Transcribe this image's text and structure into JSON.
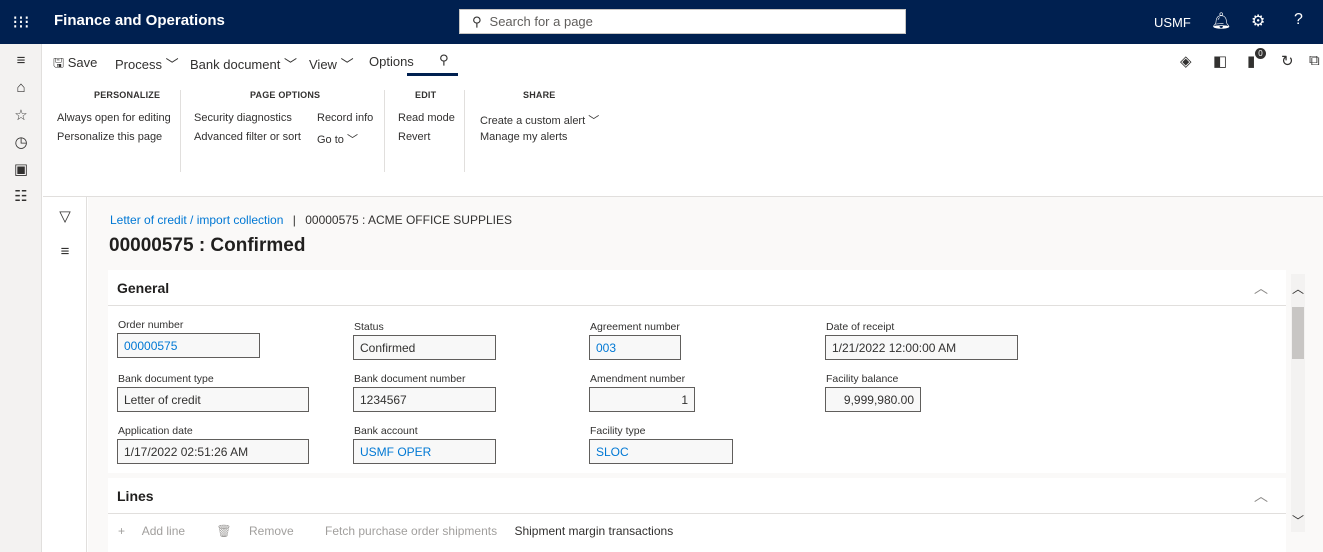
{
  "topbar": {
    "app_title": "Finance and Operations",
    "search_placeholder": "Search for a page",
    "company": "USMF",
    "help": "?"
  },
  "actions": {
    "save": "Save",
    "process": "Process",
    "bank_document": "Bank document",
    "view": "View",
    "options": "Options",
    "notification_count": "0"
  },
  "ribbon": {
    "personalize": {
      "title": "PERSONALIZE",
      "items": [
        "Always open for editing",
        "Personalize this page"
      ]
    },
    "page_options": {
      "title": "PAGE OPTIONS",
      "col1": [
        "Security diagnostics",
        "Advanced filter or sort"
      ],
      "col2": [
        "Record info",
        "Go to"
      ]
    },
    "edit": {
      "title": "EDIT",
      "items": [
        "Read mode",
        "Revert"
      ]
    },
    "share": {
      "title": "SHARE",
      "items": [
        "Create a custom alert",
        "Manage my alerts"
      ]
    }
  },
  "breadcrumb": {
    "link": "Letter of credit / import collection",
    "separator": "|",
    "current": "00000575 : ACME OFFICE SUPPLIES"
  },
  "page_title": "00000575 : Confirmed",
  "general": {
    "title": "General",
    "order_number": {
      "label": "Order number",
      "value": "00000575"
    },
    "status": {
      "label": "Status",
      "value": "Confirmed"
    },
    "agreement_number": {
      "label": "Agreement number",
      "value": "003"
    },
    "date_of_receipt": {
      "label": "Date of receipt",
      "value": "1/21/2022 12:00:00 AM"
    },
    "bank_document_type": {
      "label": "Bank document type",
      "value": "Letter of credit"
    },
    "bank_document_number": {
      "label": "Bank document number",
      "value": "1234567"
    },
    "amendment_number": {
      "label": "Amendment number",
      "value": "1"
    },
    "facility_balance": {
      "label": "Facility balance",
      "value": "9,999,980.00"
    },
    "application_date": {
      "label": "Application date",
      "value": "1/17/2022 02:51:26 AM"
    },
    "bank_account": {
      "label": "Bank account",
      "value": "USMF OPER"
    },
    "facility_type": {
      "label": "Facility type",
      "value": "SLOC"
    }
  },
  "lines": {
    "title": "Lines",
    "add_line": "Add line",
    "remove": "Remove",
    "fetch": "Fetch purchase order shipments",
    "shipment_margin": "Shipment margin transactions"
  }
}
